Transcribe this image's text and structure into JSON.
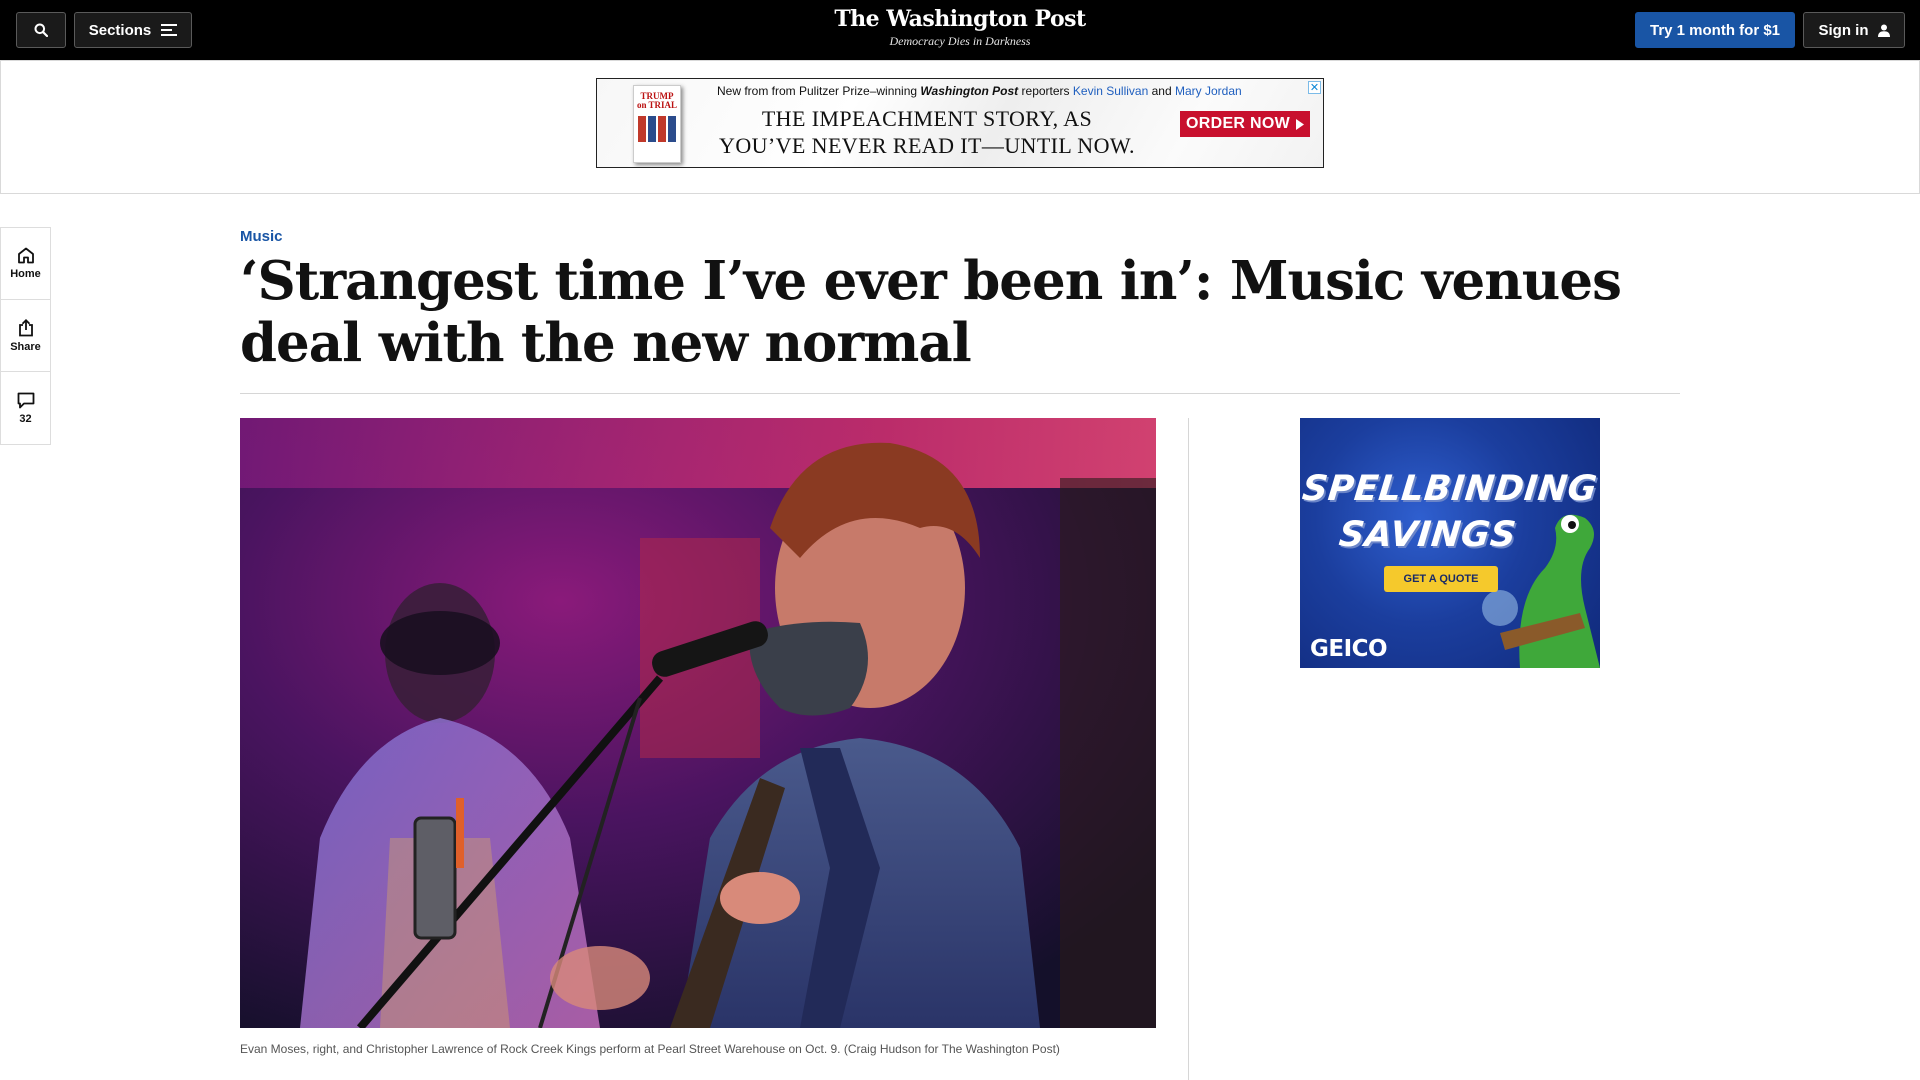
{
  "header": {
    "sections_label": "Sections",
    "logo": "The Washington Post",
    "tagline": "Democracy Dies in Darkness",
    "subscribe_label": "Try 1 month for $1",
    "signin_label": "Sign in",
    "icons": [
      "search-icon",
      "menu-icon",
      "user-icon"
    ]
  },
  "leaderboard_ad": {
    "close_label": "✕",
    "book_title_1": "TRUMP",
    "book_title_2": "on TRIAL",
    "line_prefix": "New from from Pulitzer Prize–winning",
    "line_brand": "Washington Post",
    "line_middle": "reporters",
    "author_1": "Kevin Sullivan",
    "line_and": "and",
    "author_2": "Mary Jordan",
    "headline_1": "THE IMPEACHMENT STORY, AS",
    "headline_2": "YOU’VE NEVER READ IT—UNTIL NOW.",
    "cta_label": "ORDER NOW"
  },
  "rail": {
    "home_label": "Home",
    "share_label": "Share",
    "comments_count": "32"
  },
  "article": {
    "kicker": "Music",
    "headline": "‘Strangest time I’ve ever been in’: Music venues deal with the new normal",
    "caption": "Evan Moses, right, and Christopher Lawrence of Rock Creek Kings perform at Pearl Street Warehouse on Oct. 9. (Craig Hudson for The Washington Post)"
  },
  "side_ad": {
    "headline_1": "SPELLBINDING",
    "headline_2": "SAVINGS",
    "cta_label": "GET A QUOTE",
    "brand": "GEICO"
  },
  "colors": {
    "accent_blue": "#1955a5",
    "topbar": "#000000",
    "order_red": "#c8102e",
    "quote_yellow": "#f5c92c"
  }
}
